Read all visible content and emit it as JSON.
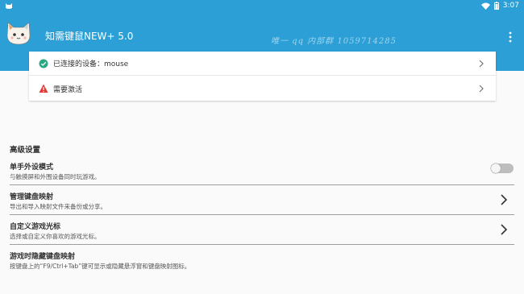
{
  "status_bar": {
    "time": "3:07"
  },
  "app_bar": {
    "title": "知需键鼠NEW+ 5.0",
    "watermark": "唯一 qq 内部群 1059714285"
  },
  "devices": {
    "connected_label": "已连接的设备：mouse",
    "activation_label": "需要激活"
  },
  "colors": {
    "app_bar": "#2b9fd6",
    "connected_icon": "#2ba883",
    "warning_icon": "#e53935",
    "toggle_track": "#bdbdbd"
  },
  "advanced": {
    "section_title": "高级设置",
    "items": [
      {
        "title": "单手外设模式",
        "subtitle": "与触摸屏和外围设备同时玩游戏。",
        "control": "toggle",
        "enabled": false
      },
      {
        "title": "管理键盘映射",
        "subtitle": "导出和导入映射文件来备份或分享。",
        "control": "chevron-right-icon"
      },
      {
        "title": "自定义游戏光标",
        "subtitle": "选择或自定义你喜欢的游戏光标。",
        "control": "chevron-right-icon"
      },
      {
        "title": "游戏时隐藏键盘映射",
        "subtitle": "按键盘上的“F9/Ctrl+Tab”键可显示或隐藏悬浮窗和键盘映射图标。",
        "control": "none"
      }
    ]
  }
}
